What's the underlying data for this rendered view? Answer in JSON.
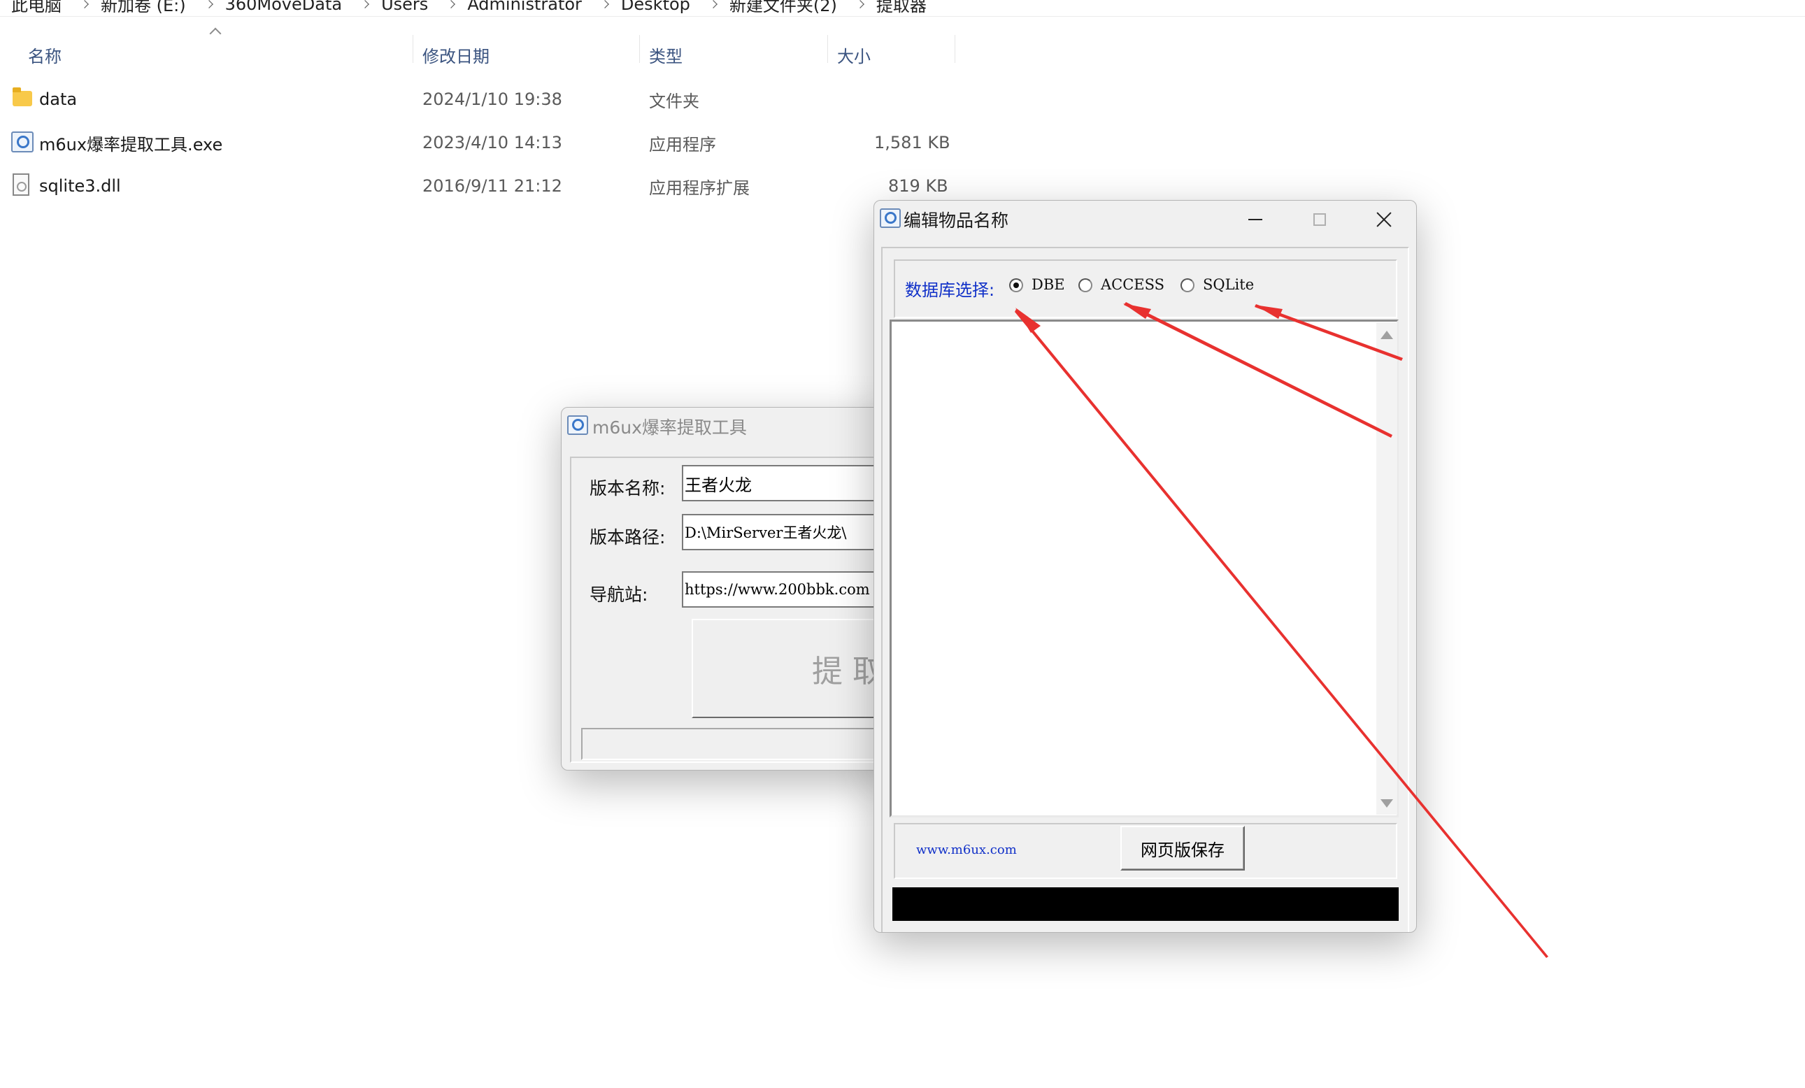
{
  "explorer": {
    "breadcrumb": [
      "此电脑",
      "新加卷 (E:)",
      "360MoveData",
      "Users",
      "Administrator",
      "Desktop",
      "新建文件夹(2)",
      "提取器"
    ],
    "columns": {
      "name": "名称",
      "date": "修改日期",
      "type": "类型",
      "size": "大小"
    },
    "files": [
      {
        "name": "data",
        "date": "2024/1/10 19:38",
        "type": "文件夹",
        "size": "",
        "icon": "folder-icon"
      },
      {
        "name": "m6ux爆率提取工具.exe",
        "date": "2023/4/10 14:13",
        "type": "应用程序",
        "size": "1,581 KB",
        "icon": "exe-icon"
      },
      {
        "name": "sqlite3.dll",
        "date": "2016/9/11 21:12",
        "type": "应用程序扩展",
        "size": "819 KB",
        "icon": "dll-icon"
      }
    ]
  },
  "extractor_window": {
    "title": "m6ux爆率提取工具",
    "version_name_label": "版本名称:",
    "version_name_value": "王者火龙",
    "version_path_label": "版本路径:",
    "version_path_value": "D:\\MirServer王者火龙\\",
    "nav_label": "导航站:",
    "nav_value": "https://www.200bbk.com",
    "extract_button": "提 取"
  },
  "editor_window": {
    "title": "编辑物品名称",
    "db_label": "数据库选择:",
    "options": [
      "DBE",
      "ACCESS",
      "SQLite"
    ],
    "selected_option": "DBE",
    "site_link": "www.m6ux.com",
    "save_button": "网页版保存"
  },
  "annotation_color": "#e8312f"
}
